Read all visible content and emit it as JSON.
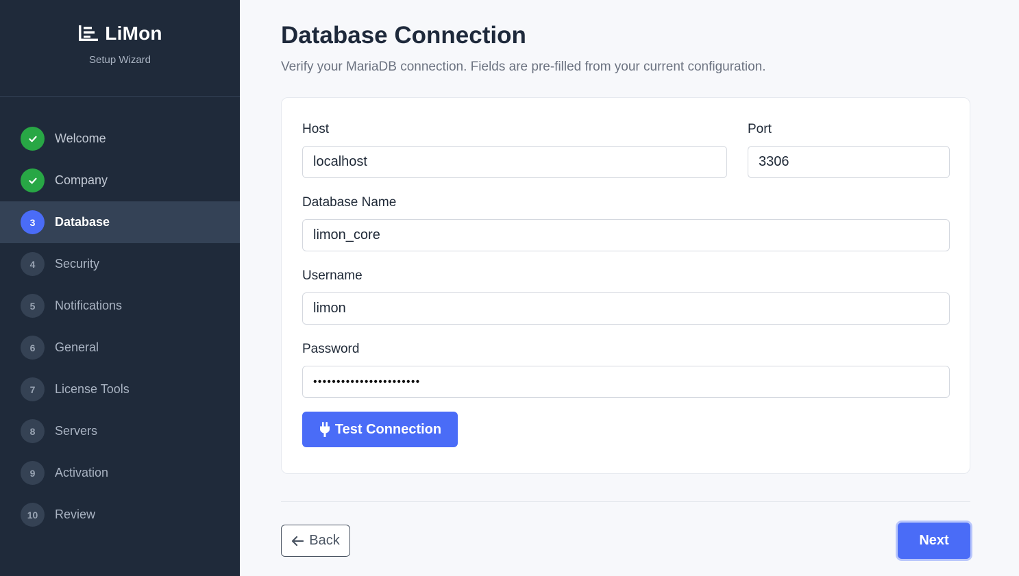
{
  "sidebar": {
    "brand": {
      "name": "LiMon",
      "subtitle": "Setup Wizard"
    },
    "steps": [
      {
        "badge": "",
        "label": "Welcome",
        "state": "done"
      },
      {
        "badge": "",
        "label": "Company",
        "state": "done"
      },
      {
        "badge": "3",
        "label": "Database",
        "state": "current"
      },
      {
        "badge": "4",
        "label": "Security",
        "state": "pending"
      },
      {
        "badge": "5",
        "label": "Notifications",
        "state": "pending"
      },
      {
        "badge": "6",
        "label": "General",
        "state": "pending"
      },
      {
        "badge": "7",
        "label": "License Tools",
        "state": "pending"
      },
      {
        "badge": "8",
        "label": "Servers",
        "state": "pending"
      },
      {
        "badge": "9",
        "label": "Activation",
        "state": "pending"
      },
      {
        "badge": "10",
        "label": "Review",
        "state": "pending"
      }
    ]
  },
  "main": {
    "title": "Database Connection",
    "subtitle": "Verify your MariaDB connection. Fields are pre-filled from your current configuration."
  },
  "form": {
    "host": {
      "label": "Host",
      "value": "localhost"
    },
    "port": {
      "label": "Port",
      "value": "3306"
    },
    "database": {
      "label": "Database Name",
      "value": "limon_core"
    },
    "username": {
      "label": "Username",
      "value": "limon"
    },
    "password": {
      "label": "Password",
      "value": "•••••••••••••••••••••••"
    },
    "test_button": "Test Connection"
  },
  "footer": {
    "back_label": "Back",
    "next_label": "Next"
  },
  "colors": {
    "sidebar_bg": "#1f2a3a",
    "accent": "#4a6cf7",
    "done": "#28a745"
  },
  "icons": {
    "logo": "chart-bars-icon",
    "test": "plug-icon",
    "back": "arrow-left-icon",
    "done": "check-icon"
  }
}
